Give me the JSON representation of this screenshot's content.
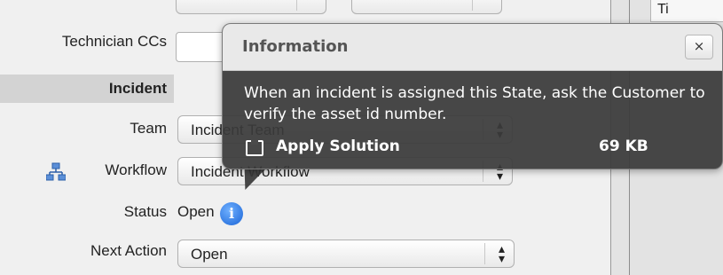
{
  "form": {
    "technician_ccs_label": "Technician CCs",
    "incident_section_label": "Incident",
    "team_label": "Team",
    "team_value": "Incident Team",
    "workflow_label": "Workflow",
    "workflow_value": "Incident Workflow",
    "status_label": "Status",
    "status_value": "Open",
    "next_action_label": "Next Action",
    "next_action_value": "Open"
  },
  "popup": {
    "title": "Information",
    "close_label": "×",
    "message": "When an incident is assigned this State, ask the Customer to verify the asset id number.",
    "attachment_name": "Apply Solution",
    "attachment_size": "69 KB"
  },
  "right_panel": {
    "cut_text": "Ti"
  },
  "icons": {
    "workflow": "workflow-icon",
    "info": "info-icon",
    "attachment": "attachment-icon",
    "close": "close-icon",
    "select_arrows": "select-arrows-icon"
  }
}
